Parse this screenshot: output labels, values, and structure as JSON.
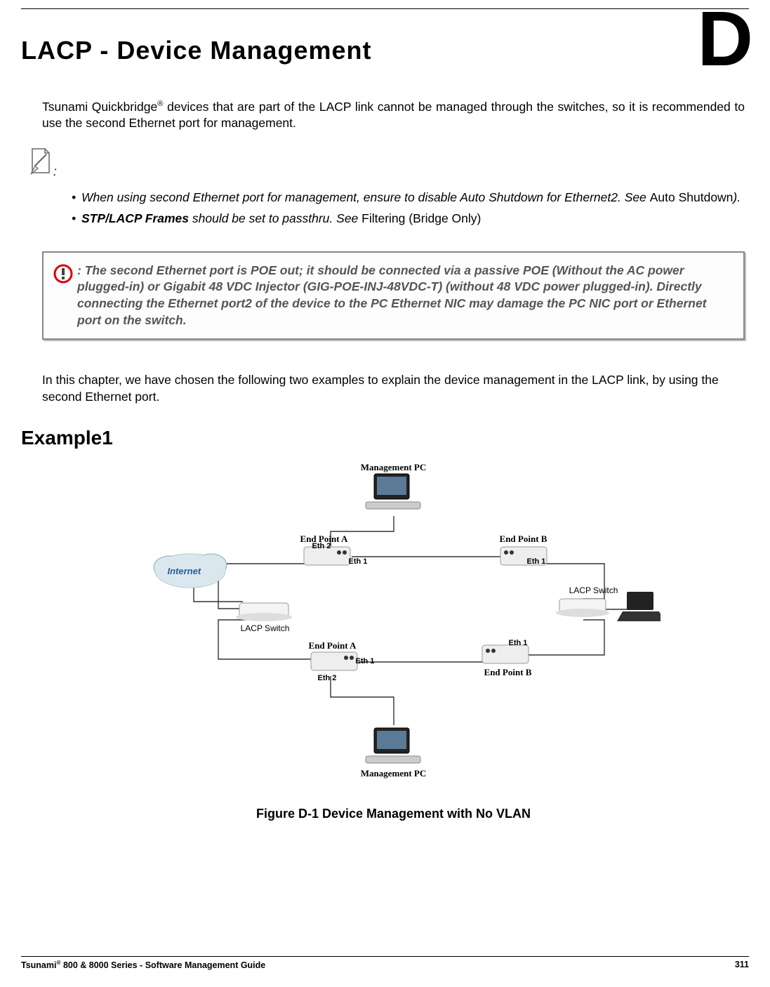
{
  "header": {
    "title": "LACP - Device Management",
    "chapter_letter": "D"
  },
  "intro": {
    "brand": "Tsunami Quickbridge",
    "rest": " devices that are part of the LACP link cannot be managed through the switches, so it is recommended to use the second Ethernet port for management."
  },
  "note_colon": ":",
  "bullets": [
    {
      "pre": "When using second Ethernet port for management, ensure to disable Auto Shutdown for Ethernet2. See ",
      "link": "Auto Shutdown",
      "post": ")."
    },
    {
      "strong": "STP/LACP Frames",
      "mid": " should be set to passthru. See ",
      "link": "Filtering (Bridge Only)"
    }
  ],
  "caution": ": The second Ethernet port is POE out; it should be connected via a passive POE (Without the AC power plugged-in) or Gigabit 48 VDC Injector (GIG-POE-INJ-48VDC-T) (without 48 VDC power plugged-in). Directly connecting the Ethernet port2 of the device to the PC Ethernet NIC may damage the PC NIC port or Ethernet port on the switch.",
  "body2": "In this chapter, we have chosen the following two examples to explain the device management in the LACP link, by using the second Ethernet port.",
  "example_heading": "Example1",
  "figure_caption": "Figure D-1 Device Management with No VLAN",
  "diagram": {
    "mgmt_pc_top": "Management PC",
    "mgmt_pc_bottom": "Management PC",
    "endpoint_a": "End Point A",
    "endpoint_b": "End Point B",
    "lacp_switch": "LACP Switch",
    "internet": "Internet",
    "eth1": "Eth 1",
    "eth2": "Eth 2"
  },
  "footer": {
    "left_pre": "Tsunami",
    "left_post": " 800 & 8000 Series - Software Management Guide",
    "page": "311"
  }
}
